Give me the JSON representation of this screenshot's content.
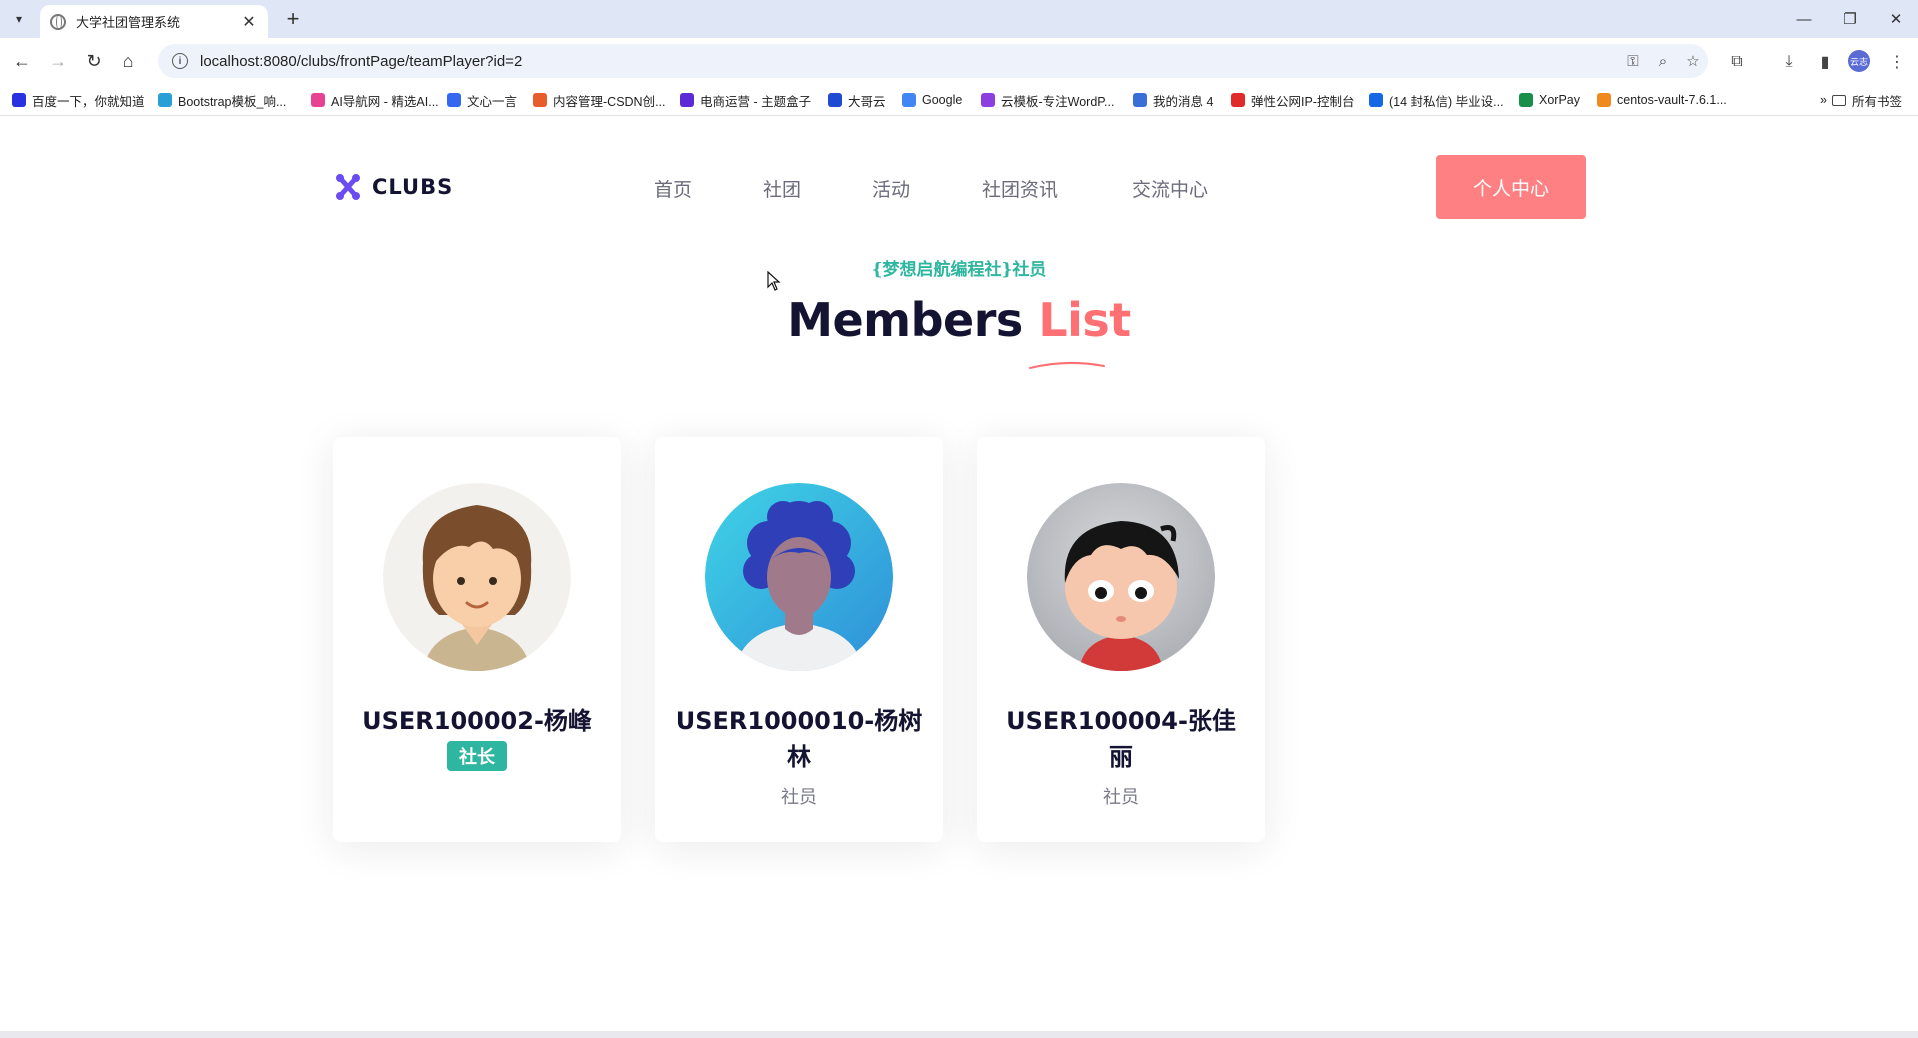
{
  "browser": {
    "tab_title": "大学社团管理系统",
    "tab_close": "✕",
    "new_tab": "+",
    "url": "localhost:8080/clubs/frontPage/teamPlayer?id=2",
    "profile_initials": "云志",
    "bookmarks": [
      {
        "label": "百度一下，你就知道",
        "color": "#2932e1",
        "icon": "paw-icon"
      },
      {
        "label": "Bootstrap模板_响...",
        "color": "#2a9fd6",
        "icon": "cloud-icon"
      },
      {
        "label": "AI导航网 - 精选AI...",
        "color": "#e84393",
        "icon": "ai-icon"
      },
      {
        "label": "文心一言",
        "color": "#3567f0",
        "icon": "cube-icon"
      },
      {
        "label": "内容管理-CSDN创...",
        "color": "#e85d2c",
        "icon": "csdn-icon"
      },
      {
        "label": "电商运营 - 主题盒子",
        "color": "#5b2bd6",
        "icon": "shield-icon"
      },
      {
        "label": "大哥云",
        "color": "#1e4bd2",
        "icon": "cloud-badge-icon"
      },
      {
        "label": "Google",
        "color": "#4285f4",
        "icon": "google-icon"
      },
      {
        "label": "云模板-专注WordP...",
        "color": "#8b3fe0",
        "icon": "swirl-icon"
      },
      {
        "label": "我的消息 4",
        "color": "#3a6fd8",
        "icon": "tv-icon"
      },
      {
        "label": "弹性公网IP-控制台",
        "color": "#e02b2b",
        "icon": "huawei-icon"
      },
      {
        "label": "(14 封私信) 毕业设...",
        "color": "#1468e6",
        "icon": "zhihu-icon"
      },
      {
        "label": "XorPay",
        "color": "#1a8f4a",
        "icon": "x-icon"
      },
      {
        "label": "centos-vault-7.6.1...",
        "color": "#f08a1c",
        "icon": "bracket-icon"
      }
    ],
    "more_bookmarks": "»",
    "all_bookmarks": "所有书签"
  },
  "header": {
    "logo_text": "CLUBS",
    "nav": [
      "首页",
      "社团",
      "活动",
      "社团资讯",
      "交流中心"
    ],
    "cta_label": "个人中心"
  },
  "section": {
    "subtitle": "{梦想启航编程社}社员",
    "heading_main": "Members",
    "heading_accent": "List"
  },
  "members": [
    {
      "name": "USER100002-杨峰",
      "role": "社长",
      "role_style": "badge",
      "avatar": "boy-brown-hair-avatar"
    },
    {
      "name": "USER1000010-杨树林",
      "role": "社员",
      "role_style": "text",
      "avatar": "curly-blue-hair-avatar"
    },
    {
      "name": "USER100004-张佳丽",
      "role": "社员",
      "role_style": "text",
      "avatar": "cartoon-child-avatar"
    }
  ],
  "colors": {
    "accent_pink": "#fe8082",
    "teal": "#2fb6a0",
    "navy": "#141432",
    "logo_purple": "#6a4cf0"
  }
}
